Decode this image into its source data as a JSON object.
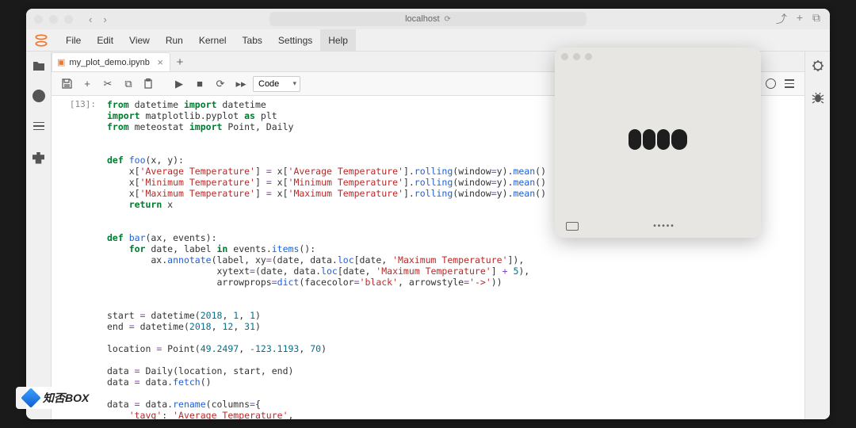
{
  "browser": {
    "address": "localhost"
  },
  "menu": {
    "items": [
      "File",
      "Edit",
      "View",
      "Run",
      "Kernel",
      "Tabs",
      "Settings",
      "Help"
    ],
    "activeIndex": 7
  },
  "tab": {
    "label": "my_plot_demo.ipynb"
  },
  "toolbar": {
    "cellType": "Code"
  },
  "kernel": {
    "trailing": ")"
  },
  "cell": {
    "prompt": "[13]:",
    "code_html": "<span class=\"kw\">from</span> datetime <span class=\"kw\">import</span> datetime\n<span class=\"kw\">import</span> matplotlib.pyplot <span class=\"kw\">as</span> plt\n<span class=\"kw\">from</span> meteostat <span class=\"kw\">import</span> Point, Daily\n\n\n<span class=\"kw\">def</span> <span class=\"fn\">foo</span>(x, y):\n    x[<span class=\"str\">'Average Temperature'</span>] <span class=\"op\">=</span> x[<span class=\"str\">'Average Temperature'</span>].<span class=\"fn\">rolling</span>(window<span class=\"op\">=</span>y).<span class=\"fn\">mean</span>()\n    x[<span class=\"str\">'Minimum Temperature'</span>] <span class=\"op\">=</span> x[<span class=\"str\">'Minimum Temperature'</span>].<span class=\"fn\">rolling</span>(window<span class=\"op\">=</span>y).<span class=\"fn\">mean</span>()\n    x[<span class=\"str\">'Maximum Temperature'</span>] <span class=\"op\">=</span> x[<span class=\"str\">'Maximum Temperature'</span>].<span class=\"fn\">rolling</span>(window<span class=\"op\">=</span>y).<span class=\"fn\">mean</span>()\n    <span class=\"kw\">return</span> x\n\n\n<span class=\"kw\">def</span> <span class=\"fn\">bar</span>(ax, events):\n    <span class=\"kw\">for</span> date, label <span class=\"kw\">in</span> events.<span class=\"fn\">items</span>():\n        ax.<span class=\"fn\">annotate</span>(label, xy<span class=\"op\">=</span>(date, data.<span class=\"fn\">loc</span>[date, <span class=\"str\">'Maximum Temperature'</span>]),\n                    xytext<span class=\"op\">=</span>(date, data.<span class=\"fn\">loc</span>[date, <span class=\"str\">'Maximum Temperature'</span>] <span class=\"op\">+</span> <span class=\"num\">5</span>),\n                    arrowprops<span class=\"op\">=</span><span class=\"fn\">dict</span>(facecolor<span class=\"op\">=</span><span class=\"str\">'black'</span>, arrowstyle<span class=\"op\">=</span><span class=\"str\">'-&gt;'</span>))\n\n\nstart <span class=\"op\">=</span> datetime(<span class=\"num\">2018</span>, <span class=\"num\">1</span>, <span class=\"num\">1</span>)\nend <span class=\"op\">=</span> datetime(<span class=\"num\">2018</span>, <span class=\"num\">12</span>, <span class=\"num\">31</span>)\n\nlocation <span class=\"op\">=</span> Point(<span class=\"num\">49.2497</span>, <span class=\"num\">-123.1193</span>, <span class=\"num\">70</span>)\n\ndata <span class=\"op\">=</span> Daily(location, start, end)\ndata <span class=\"op\">=</span> data.<span class=\"fn\">fetch</span>()\n\ndata <span class=\"op\">=</span> data.<span class=\"fn\">rename</span>(columns<span class=\"op\">=</span>{\n    <span class=\"str\">'tavg'</span>: <span class=\"str\">'Average Temperature'</span>,"
  },
  "overlay": {
    "footerDots": "•••••"
  },
  "watermark": {
    "text": "知否BOX"
  }
}
